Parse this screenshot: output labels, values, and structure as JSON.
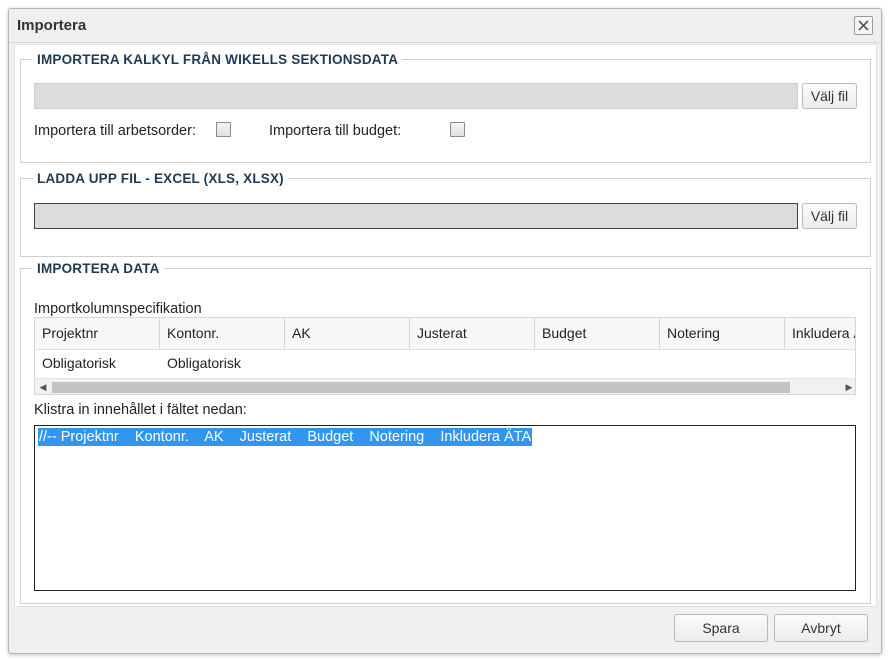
{
  "dialog": {
    "title": "Importera",
    "close_icon": "close-icon"
  },
  "wikells": {
    "legend": "IMPORTERA KALKYL FRÅN WIKELLS SEKTIONSDATA",
    "file_value": "",
    "choose_label": "Välj fil",
    "workorder_label": "Importera till arbetsorder:",
    "budget_label": "Importera till budget:",
    "workorder_checked": false,
    "budget_checked": false
  },
  "excel": {
    "legend": "LADDA UPP FIL - EXCEL (XLS, XLSX)",
    "file_value": "",
    "choose_label": "Välj fil"
  },
  "import_data": {
    "legend": "IMPORTERA DATA",
    "spec_label": "Importkolumnspecifikation",
    "columns": [
      "Projektnr",
      "Kontonr.",
      "AK",
      "Justerat",
      "Budget",
      "Notering",
      "Inkludera ÄTA"
    ],
    "rows": [
      [
        "Obligatorisk",
        "Obligatorisk",
        "",
        "",
        "",
        "",
        ""
      ]
    ],
    "paste_label": "Klistra in innehållet i fältet nedan:",
    "textarea_value": "//-- Projektnr    Kontonr.    AK    Justerat    Budget    Notering    Inkludera ÄTA"
  },
  "footer": {
    "save_label": "Spara",
    "cancel_label": "Avbryt"
  }
}
